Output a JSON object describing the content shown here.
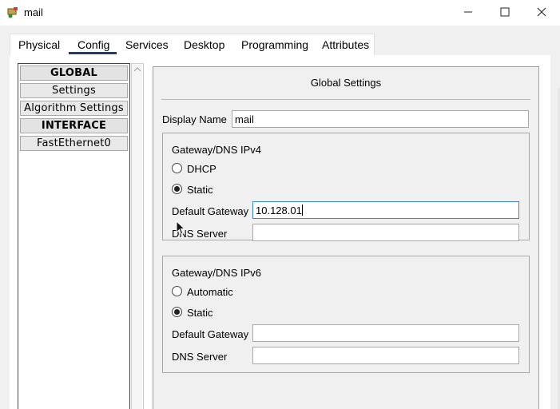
{
  "window": {
    "title": "mail"
  },
  "tabs": [
    "Physical",
    "Config",
    "Services",
    "Desktop",
    "Programming",
    "Attributes"
  ],
  "sidebar": {
    "items": [
      {
        "label": "GLOBAL",
        "header": true
      },
      {
        "label": "Settings",
        "header": false
      },
      {
        "label": "Algorithm Settings",
        "header": false
      },
      {
        "label": "INTERFACE",
        "header": true
      },
      {
        "label": "FastEthernet0",
        "header": false
      }
    ]
  },
  "settings": {
    "title": "Global Settings",
    "display_name_label": "Display Name",
    "display_name_value": "mail",
    "ipv4": {
      "group_label": "Gateway/DNS IPv4",
      "option1": "DHCP",
      "option2": "Static",
      "selected": "Static",
      "gateway_label": "Default Gateway",
      "gateway_value": "10.128.01",
      "dns_label": "DNS Server",
      "dns_value": ""
    },
    "ipv6": {
      "group_label": "Gateway/DNS IPv6",
      "option1": "Automatic",
      "option2": "Static",
      "selected": "Static",
      "gateway_label": "Default Gateway",
      "gateway_value": "",
      "dns_label": "DNS Server",
      "dns_value": ""
    }
  },
  "colors": {
    "active_tab_underline": "#1f3b6b",
    "focus_border": "#3c7fd4"
  }
}
